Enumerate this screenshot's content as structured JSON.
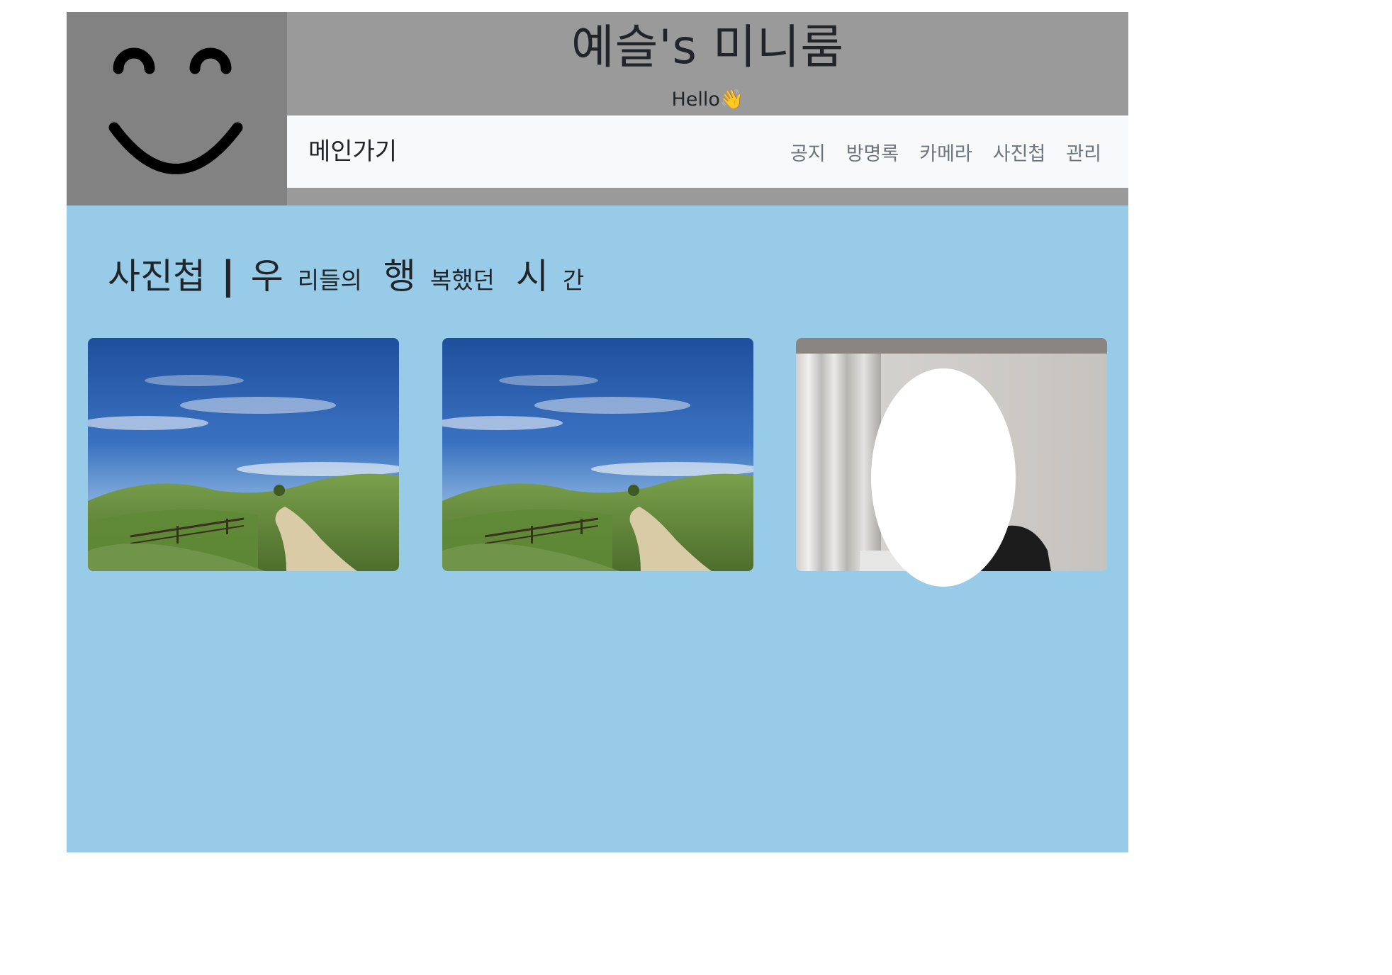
{
  "header": {
    "title": "예슬's 미니룸",
    "greeting": "Hello",
    "greeting_emoji": "👋",
    "logo_icon": "smiley-face-icon"
  },
  "nav": {
    "brand": "메인가기",
    "links": [
      "공지",
      "방명록",
      "카메라",
      "사진첩",
      "관리"
    ]
  },
  "gallery": {
    "title_main": "사진첩",
    "separator": "|",
    "title_parts": [
      {
        "big": "우",
        "small": "리들의"
      },
      {
        "big": "행",
        "small": "복했던"
      },
      {
        "big": "시",
        "small": "간"
      }
    ],
    "photos": [
      {
        "subject": "landscape-photo-hill-road"
      },
      {
        "subject": "landscape-photo-hill-road"
      },
      {
        "subject": "person-photo-face-covered"
      }
    ]
  },
  "colors": {
    "header_bg": "#9a9a9a",
    "logo_bg": "#828282",
    "navbar_bg": "#f8f9fa",
    "content_bg": "#97cbe7"
  }
}
